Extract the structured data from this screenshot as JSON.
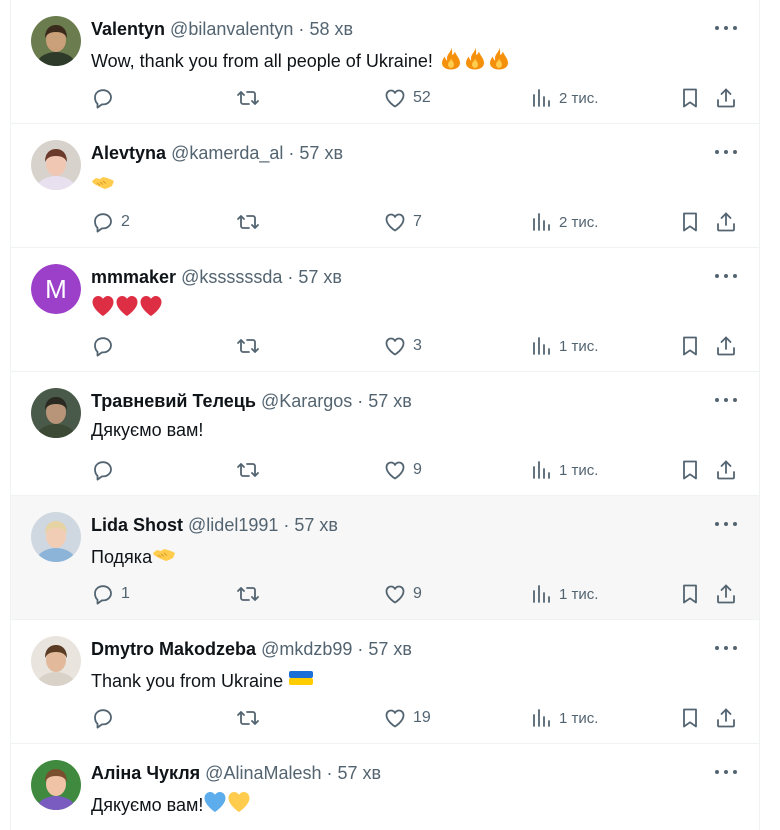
{
  "tweets": [
    {
      "name": "Valentyn",
      "handle": "@bilanvalentyn",
      "separator": "·",
      "time": "58 хв",
      "text": "Wow, thank you from all people of Ukraine!",
      "emojis": [
        "fire",
        "fire",
        "fire"
      ],
      "avatar": {
        "type": "photo",
        "bg": "#6b7d4f",
        "face": "#c9a07a",
        "hair": "#3a2b1d",
        "shirt": "#2e3a2a"
      },
      "replies": "",
      "retweets": "",
      "likes": "52",
      "views": "2 тис."
    },
    {
      "name": "Alevtyna",
      "handle": "@kamerda_al",
      "separator": "·",
      "time": "57 хв",
      "text": "",
      "emojis": [
        "handshake"
      ],
      "avatar": {
        "type": "photo",
        "bg": "#d8d2cc",
        "face": "#f0c7b3",
        "hair": "#6b3a2a",
        "shirt": "#e8e0ef"
      },
      "replies": "2",
      "retweets": "",
      "likes": "7",
      "views": "2 тис."
    },
    {
      "name": "mmmaker",
      "handle": "@kssssssda",
      "separator": "·",
      "time": "57 хв",
      "text": "",
      "emojis": [
        "red-heart",
        "red-heart",
        "red-heart"
      ],
      "avatar": {
        "type": "letter",
        "letter": "M",
        "bg": "#9c3fc9"
      },
      "replies": "",
      "retweets": "",
      "likes": "3",
      "views": "1 тис."
    },
    {
      "name": "Травневий Телець",
      "handle": "@Karargos",
      "separator": "·",
      "time": "57 хв",
      "text": "Дякуємо вам!",
      "emojis": [],
      "avatar": {
        "type": "photo",
        "bg": "#4a5a4a",
        "face": "#b89478",
        "hair": "#2a2a22",
        "shirt": "#3c4a35"
      },
      "replies": "",
      "retweets": "",
      "likes": "9",
      "views": "1 тис."
    },
    {
      "name": "Lida Shost",
      "handle": "@lidel1991",
      "separator": "·",
      "time": "57 хв",
      "text": "Подяка",
      "emojis": [
        "handshake"
      ],
      "avatar": {
        "type": "photo",
        "bg": "#cfd8e0",
        "face": "#f1cdb5",
        "hair": "#e6d3a3",
        "shirt": "#8cb4d8"
      },
      "replies": "1",
      "retweets": "",
      "likes": "9",
      "views": "1 тис."
    },
    {
      "name": "Dmytro Makodzeba",
      "handle": "@mkdzb99",
      "separator": "·",
      "time": "57 хв",
      "text": "Thank you from Ukraine",
      "emojis": [
        "ukraine-flag"
      ],
      "avatar": {
        "type": "photo",
        "bg": "#e9e4de",
        "face": "#e2b99a",
        "hair": "#5a3b24",
        "shirt": "#d9d2c9"
      },
      "replies": "",
      "retweets": "",
      "likes": "19",
      "views": "1 тис."
    },
    {
      "name": "Аліна Чукля",
      "handle": "@AlinaMalesh",
      "separator": "·",
      "time": "57 хв",
      "text": "Дякуємо вам!",
      "emojis": [
        "blue-heart",
        "yellow-heart"
      ],
      "avatar": {
        "type": "photo",
        "bg": "#3f8a3f",
        "face": "#f0c3a6",
        "hair": "#7a4f2f",
        "shirt": "#7a5bbf"
      },
      "replies": "",
      "retweets": "",
      "likes": "",
      "views": ""
    }
  ],
  "icons": {
    "reply": "reply-icon",
    "retweet": "retweet-icon",
    "like": "heart-icon",
    "views": "views-icon",
    "bookmark": "bookmark-icon",
    "share": "share-icon",
    "more": "more-icon"
  },
  "colors": {
    "text": "#0f1419",
    "secondary": "#536471",
    "border": "#eff3f4",
    "hover_bg": "#f7f7f7"
  }
}
